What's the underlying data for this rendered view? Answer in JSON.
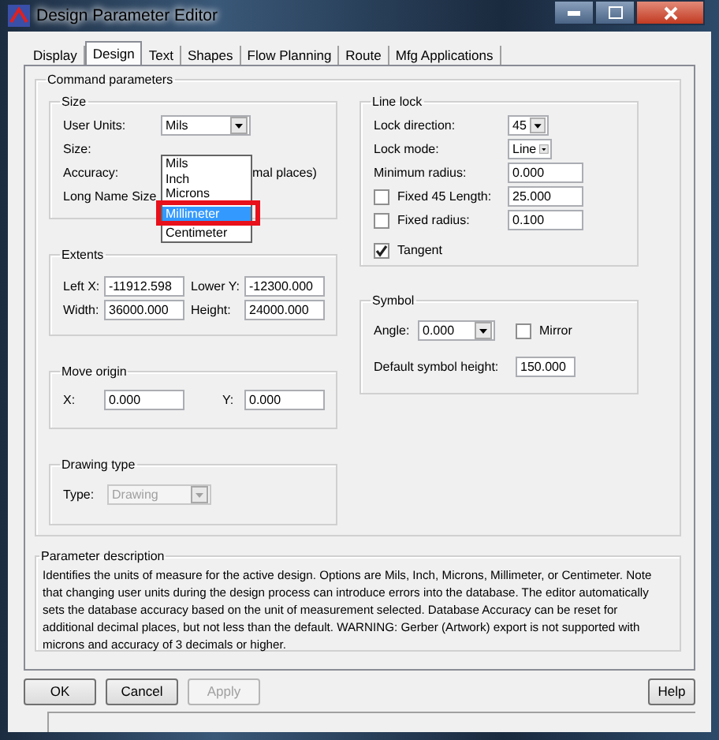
{
  "window": {
    "title": "Design Parameter Editor"
  },
  "tabs": [
    {
      "label": "Display",
      "selected": false
    },
    {
      "label": "Design",
      "selected": true
    },
    {
      "label": "Text",
      "selected": false
    },
    {
      "label": "Shapes",
      "selected": false
    },
    {
      "label": "Flow Planning",
      "selected": false
    },
    {
      "label": "Route",
      "selected": false
    },
    {
      "label": "Mfg Applications",
      "selected": false
    }
  ],
  "command_parameters": {
    "title": "Command parameters",
    "size": {
      "title": "Size",
      "user_units": {
        "label": "User Units:",
        "value": "Mils"
      },
      "size_label": "Size:",
      "accuracy_label": "Accuracy:",
      "accuracy_suffix": "mal places)",
      "long_name_label": "Long Name Size",
      "units_list": [
        {
          "label": "Mils",
          "selected": false
        },
        {
          "label": "Inch",
          "selected": false
        },
        {
          "label": "Microns",
          "selected": false
        },
        {
          "label": "Millimeter",
          "selected": true
        },
        {
          "label": "Centimeter",
          "selected": false
        }
      ]
    },
    "extents": {
      "title": "Extents",
      "fields": [
        {
          "label": "Left X:",
          "value": "-11912.598"
        },
        {
          "label": "Lower Y:",
          "value": "-12300.000"
        },
        {
          "label": "Width:",
          "value": "36000.000"
        },
        {
          "label": "Height:",
          "value": "24000.000"
        }
      ]
    },
    "move_origin": {
      "title": "Move origin",
      "fields": [
        {
          "label": "X:",
          "value": "0.000"
        },
        {
          "label": "Y:",
          "value": "0.000"
        }
      ]
    },
    "drawing_type": {
      "title": "Drawing type",
      "label": "Type:",
      "value": "Drawing",
      "disabled": true
    },
    "line_lock": {
      "title": "Line lock",
      "rows": [
        {
          "kind": "combo",
          "label": "Lock direction:",
          "value": "45"
        },
        {
          "kind": "combo",
          "label": "Lock mode:",
          "value": "Line"
        },
        {
          "kind": "field",
          "label": "Minimum radius:",
          "value": "0.000"
        },
        {
          "kind": "check",
          "label": "Fixed 45 Length:",
          "checked": false,
          "value": "25.000"
        },
        {
          "kind": "check",
          "label": "Fixed radius:",
          "checked": false,
          "value": "0.100"
        },
        {
          "kind": "check",
          "label": "Tangent",
          "checked": true
        }
      ]
    },
    "symbol": {
      "title": "Symbol",
      "angle": {
        "label": "Angle:",
        "value": "0.000"
      },
      "mirror": {
        "label": "Mirror",
        "checked": false
      },
      "height": {
        "label": "Default symbol height:",
        "value": "150.000"
      }
    }
  },
  "parameter_description": {
    "title": "Parameter description",
    "text": "Identifies the units of measure for the active design. Options are Mils, Inch, Microns, Millimeter, or Centimeter. Note that changing user units during the design process can introduce errors into the database.  The editor automatically sets the database accuracy based on the unit of measurement selected. Database Accuracy can be reset for additional decimal places, but not less than the default. WARNING: Gerber (Artwork) export is not supported with microns and accuracy of 3 decimals or higher."
  },
  "buttons": [
    {
      "label": "OK",
      "disabled": false
    },
    {
      "label": "Cancel",
      "disabled": false
    },
    {
      "label": "Apply",
      "disabled": true
    },
    {
      "label": "Help",
      "disabled": false
    }
  ]
}
